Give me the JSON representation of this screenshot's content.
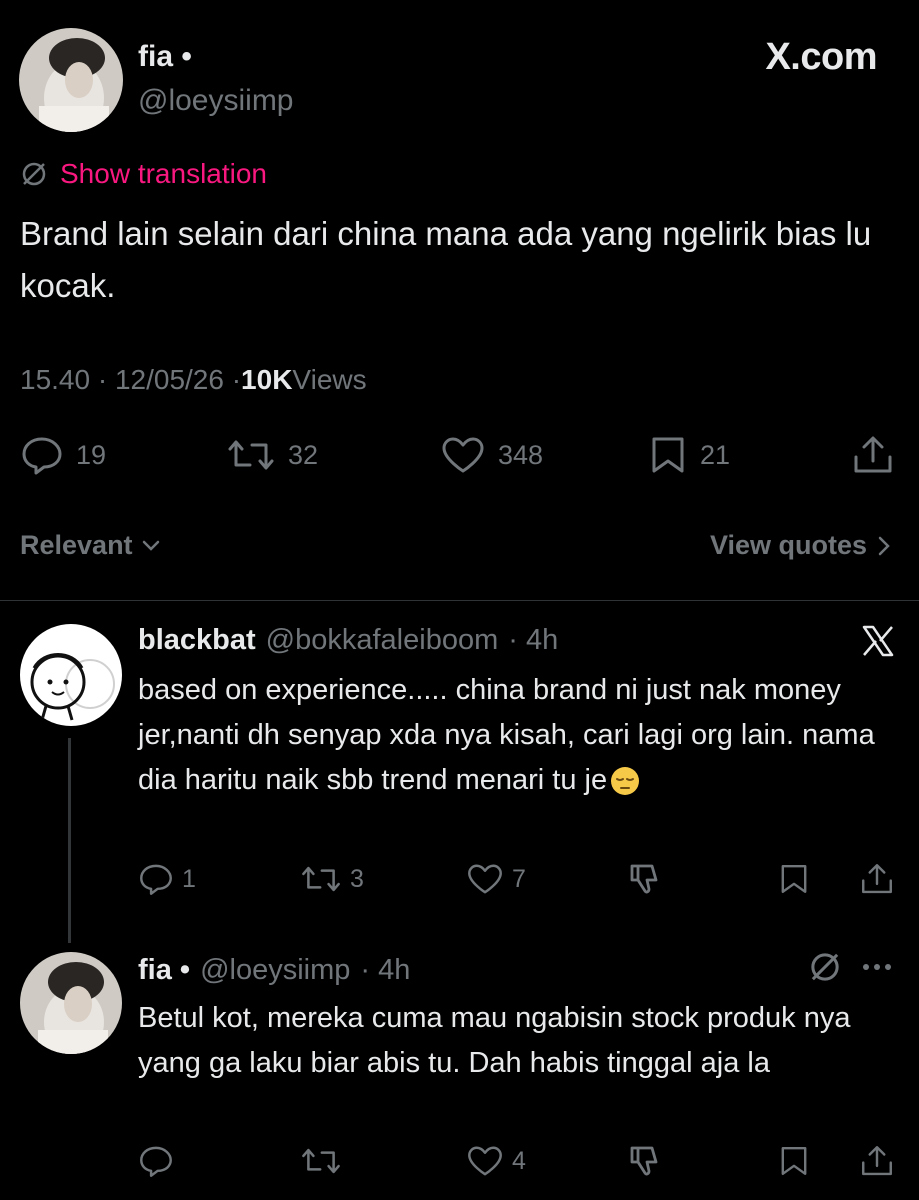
{
  "main_post": {
    "display_name": "fia •",
    "handle": "@loeysiimp",
    "source": "X.com",
    "translate_label": "Show translation",
    "text": "Brand lain selain dari china mana ada yang ngelirik bias lu kocak.",
    "time": "15.40 · 12/05/26 · ",
    "views_count": "10K",
    "views_label": " Views",
    "stats": {
      "replies": "19",
      "reposts": "32",
      "likes": "348",
      "bookmarks": "21"
    }
  },
  "sort": {
    "relevant_label": "Relevant",
    "view_quotes_label": "View quotes"
  },
  "replies": [
    {
      "display_name": "blackbat",
      "handle": "@bokkafaleiboom",
      "time": "· 4h",
      "text": "based on experience..... china brand ni just nak money jer,nanti dh senyap xda nya kisah, cari lagi org lain. nama dia haritu naik sbb trend menari tu je",
      "emoji": "😔",
      "stats": {
        "replies": "1",
        "reposts": "3",
        "likes": "7"
      }
    },
    {
      "display_name": "fia •",
      "handle": "@loeysiimp",
      "time": "· 4h",
      "text": "Betul kot, mereka cuma mau ngabisin stock produk nya yang ga laku biar abis tu. Dah habis tinggal aja la",
      "stats": {
        "likes": "4"
      }
    }
  ],
  "colors": {
    "background": "#000000",
    "text": "#e7e9ea",
    "muted": "#71767b",
    "accent_pink": "#f91880",
    "divider": "#2f3336"
  }
}
